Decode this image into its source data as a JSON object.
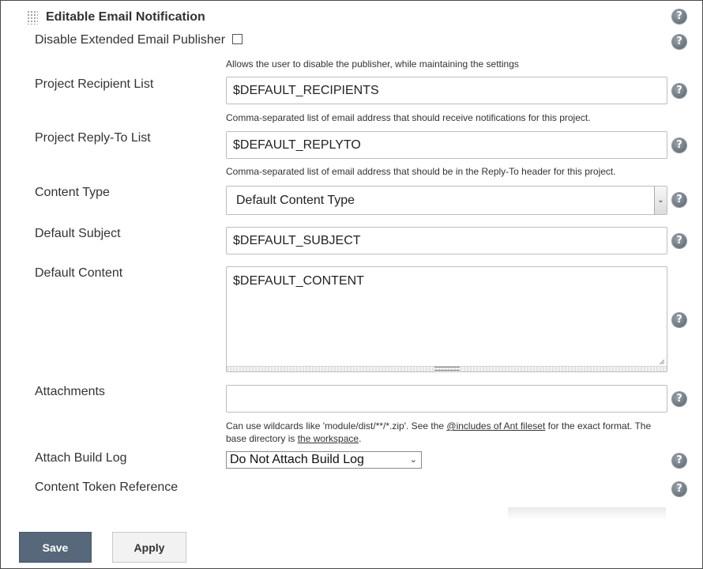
{
  "section": {
    "title": "Editable Email Notification"
  },
  "help_glyph": "?",
  "disable_publisher": {
    "label": "Disable Extended Email Publisher",
    "checked": false,
    "description": "Allows the user to disable the publisher, while maintaining the settings"
  },
  "recipient_list": {
    "label": "Project Recipient List",
    "value": "$DEFAULT_RECIPIENTS",
    "description": "Comma-separated list of email address that should receive notifications for this project."
  },
  "reply_to_list": {
    "label": "Project Reply-To List",
    "value": "$DEFAULT_REPLYTO",
    "description": "Comma-separated list of email address that should be in the Reply-To header for this project."
  },
  "content_type": {
    "label": "Content Type",
    "selected": "Default Content Type",
    "arrow": "⌄"
  },
  "default_subject": {
    "label": "Default Subject",
    "value": "$DEFAULT_SUBJECT"
  },
  "default_content": {
    "label": "Default Content",
    "value": "$DEFAULT_CONTENT"
  },
  "attachments": {
    "label": "Attachments",
    "value": "",
    "description_pre": "Can use wildcards like 'module/dist/**/*.zip'. See the ",
    "link_fileset": "@includes of Ant fileset",
    "description_mid": " for the exact format. The base directory is ",
    "link_workspace": "the workspace",
    "description_post": "."
  },
  "attach_build_log": {
    "label": "Attach Build Log",
    "selected": "Do Not Attach Build Log",
    "arrow": "⌄"
  },
  "content_token_reference": {
    "label": "Content Token Reference"
  },
  "buttons": {
    "save": "Save",
    "apply": "Apply"
  },
  "colors": {
    "save_button": "#56687a",
    "help_icon": "#6b757e"
  }
}
